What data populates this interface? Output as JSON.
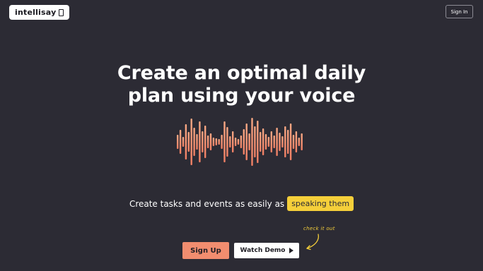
{
  "header": {
    "logo_text": "intellisay",
    "signin_label": "Sign In"
  },
  "hero": {
    "headline_line1": "Create an optimal daily",
    "headline_line2": "plan using your voice",
    "subline_text": "Create tasks and events as easily as",
    "subline_highlight": "speaking them"
  },
  "actions": {
    "signup_label": "Sign Up",
    "demo_label": "Watch Demo",
    "note_text": "check it out"
  },
  "colors": {
    "background": "#2c2b34",
    "accent_orange": "#f28d6f",
    "accent_yellow": "#f5cf3a",
    "wave_top": "#f7a07e",
    "wave_bottom": "#f48a6a"
  },
  "icons": {
    "logo": "device-icon",
    "demo": "play-icon",
    "note": "curved-arrow-icon",
    "wave": "voice-waveform-icon"
  }
}
